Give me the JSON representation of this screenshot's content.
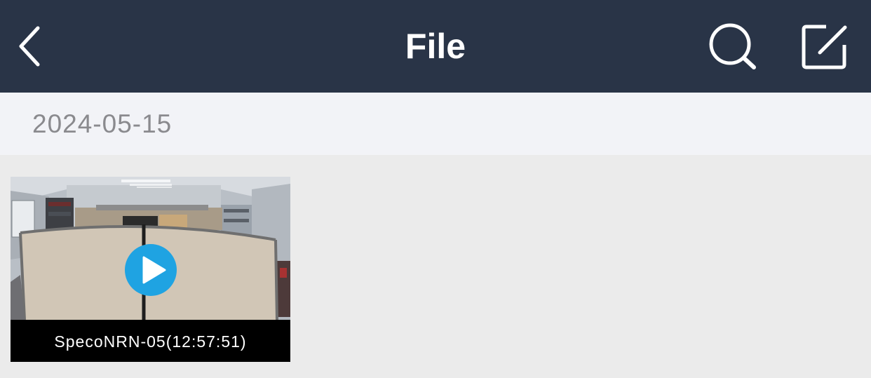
{
  "navbar": {
    "title": "File",
    "back_icon": "chevron-left-icon",
    "search_icon": "search-icon",
    "edit_icon": "edit-icon",
    "background": "#293447"
  },
  "section": {
    "date": "2024-05-15"
  },
  "files": [
    {
      "caption": "SpecoNRN-05(12:57:51)",
      "thumbnail": "office-cubicles-camera-view",
      "play_icon": "play-icon",
      "play_color": "#1fa3e2"
    }
  ]
}
